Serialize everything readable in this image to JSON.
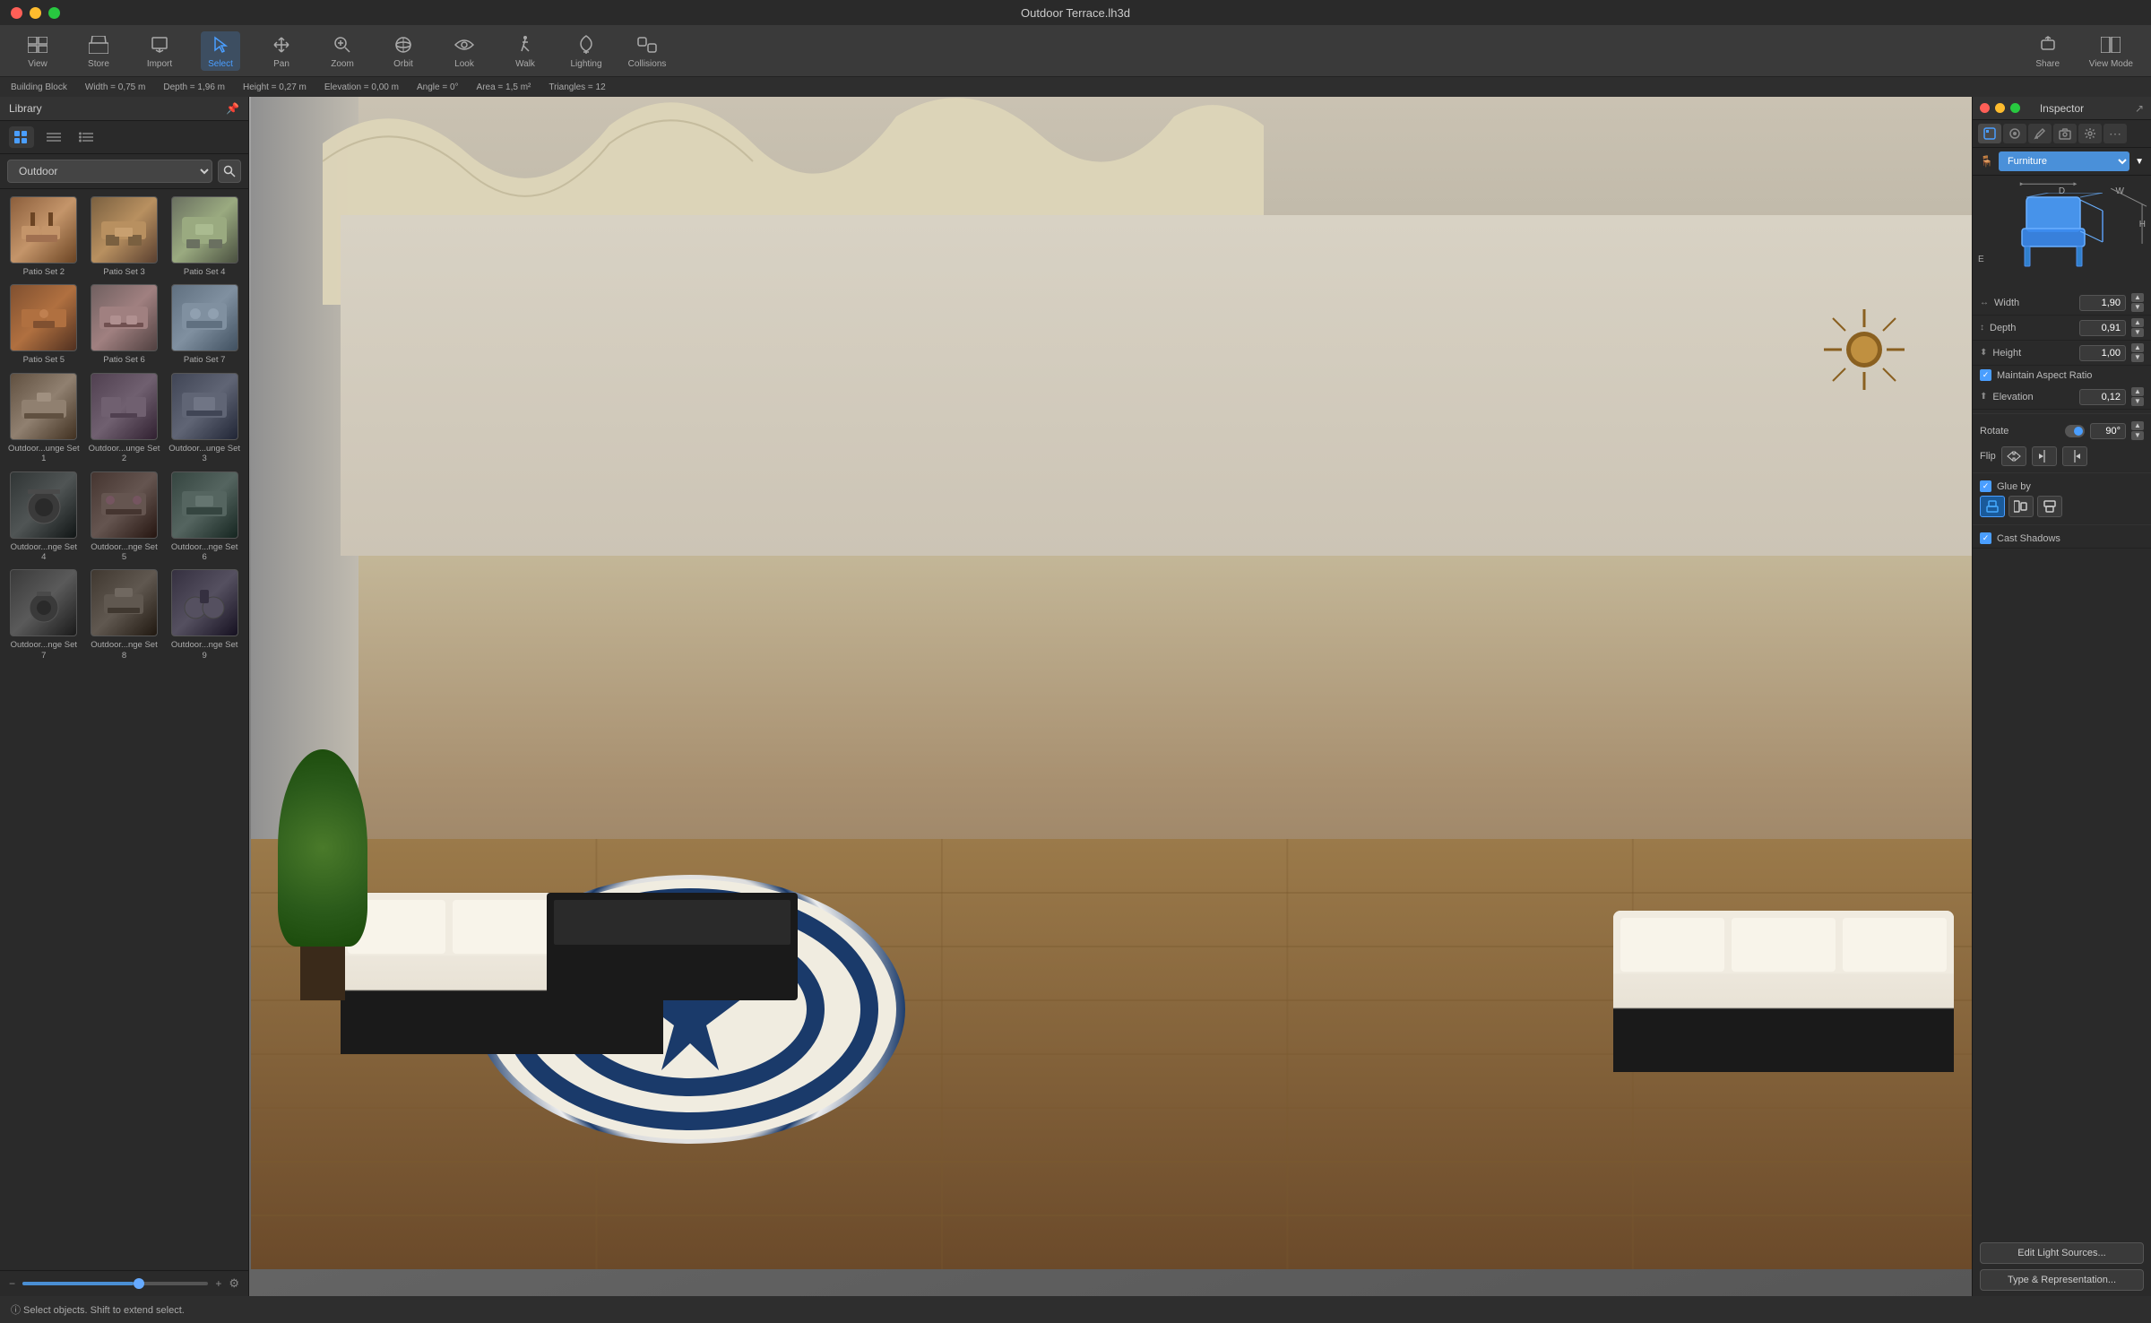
{
  "window": {
    "title": "Outdoor Terrace.lh3d"
  },
  "titlebar": {
    "title": "Outdoor Terrace.lh3d"
  },
  "toolbar": {
    "items": [
      {
        "id": "view",
        "label": "View",
        "icon": "🖥"
      },
      {
        "id": "store",
        "label": "Store",
        "icon": "🏪"
      },
      {
        "id": "import",
        "label": "Import",
        "icon": "📥"
      },
      {
        "id": "select",
        "label": "Select",
        "icon": "↖"
      },
      {
        "id": "pan",
        "label": "Pan",
        "icon": "✋"
      },
      {
        "id": "zoom",
        "label": "Zoom",
        "icon": "🔍"
      },
      {
        "id": "orbit",
        "label": "Orbit",
        "icon": "🔄"
      },
      {
        "id": "look",
        "label": "Look",
        "icon": "👁"
      },
      {
        "id": "walk",
        "label": "Walk",
        "icon": "🚶"
      },
      {
        "id": "lighting",
        "label": "Lighting",
        "icon": "💡"
      },
      {
        "id": "collisions",
        "label": "Collisions",
        "icon": "⚡"
      }
    ],
    "right_items": [
      {
        "id": "share",
        "label": "Share",
        "icon": "↑"
      },
      {
        "id": "view_mode",
        "label": "View Mode",
        "icon": "▣"
      }
    ]
  },
  "statusbar": {
    "building_block": "Building Block",
    "width": "Width = 0,75 m",
    "depth": "Depth = 1,96 m",
    "height": "Height = 0,27 m",
    "elevation": "Elevation = 0,00 m",
    "angle": "Angle = 0°",
    "area": "Area = 1,5 m²",
    "triangles": "Triangles = 12"
  },
  "library": {
    "title": "Library",
    "dropdown_value": "Outdoor",
    "items": [
      {
        "id": "patio2",
        "label": "Patio Set 2",
        "thumb_class": "thumb-patio2"
      },
      {
        "id": "patio3",
        "label": "Patio Set 3",
        "thumb_class": "thumb-patio3"
      },
      {
        "id": "patio4",
        "label": "Patio Set 4",
        "thumb_class": "thumb-patio4"
      },
      {
        "id": "patio5",
        "label": "Patio Set 5",
        "thumb_class": "thumb-patio5"
      },
      {
        "id": "patio6",
        "label": "Patio Set 6",
        "thumb_class": "thumb-patio6"
      },
      {
        "id": "patio7",
        "label": "Patio Set 7",
        "thumb_class": "thumb-patio7"
      },
      {
        "id": "lounge1",
        "label": "Outdoor...unge Set 1",
        "thumb_class": "thumb-lounge1"
      },
      {
        "id": "lounge2",
        "label": "Outdoor...unge Set 2",
        "thumb_class": "thumb-lounge2"
      },
      {
        "id": "lounge3",
        "label": "Outdoor...unge Set 3",
        "thumb_class": "thumb-lounge3"
      },
      {
        "id": "lounge4",
        "label": "Outdoor...nge Set 4",
        "thumb_class": "thumb-lounge4"
      },
      {
        "id": "lounge5",
        "label": "Outdoor...nge Set 5",
        "thumb_class": "thumb-lounge5"
      },
      {
        "id": "lounge6",
        "label": "Outdoor...nge Set 6",
        "thumb_class": "thumb-lounge6"
      },
      {
        "id": "lounge7",
        "label": "Outdoor...nge Set 7",
        "thumb_class": "thumb-lounge7"
      },
      {
        "id": "lounge8",
        "label": "Outdoor...nge Set 8",
        "thumb_class": "thumb-lounge8"
      },
      {
        "id": "lounge9",
        "label": "Outdoor...nge Set 9",
        "thumb_class": "thumb-lounge9"
      }
    ],
    "zoom_level": 60
  },
  "inspector": {
    "title": "Inspector",
    "category": "Furniture",
    "dimensions": {
      "d_label": "D",
      "w_label": "W",
      "h_label": "H",
      "e_label": "E"
    },
    "width_label": "Width",
    "width_value": "1,90",
    "depth_label": "Depth",
    "depth_value": "0,91",
    "height_label": "Height",
    "height_value": "1,00",
    "maintain_aspect_ratio": "Maintain Aspect Ratio",
    "elevation_label": "Elevation",
    "elevation_value": "0,12",
    "rotate_label": "Rotate",
    "rotate_value": "90°",
    "flip_label": "Flip",
    "glue_by_label": "Glue by",
    "cast_shadows_label": "Cast Shadows",
    "edit_light_sources_btn": "Edit Light Sources...",
    "type_representation_btn": "Type & Representation..."
  },
  "bottombar": {
    "status_text": "ⓘ  Select objects. Shift to extend select."
  }
}
